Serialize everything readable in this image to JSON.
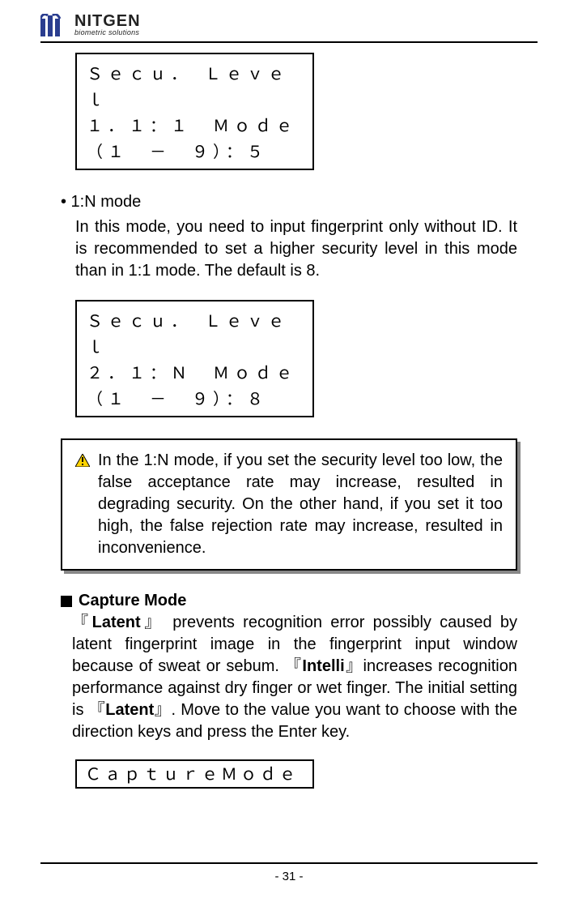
{
  "header": {
    "logo_main": "NITGEN",
    "logo_sub": "biometric solutions"
  },
  "display1": {
    "line1": "Ｓｅｃｕ．　Ｌｅｖｅｌ",
    "line2": "１．１：１　Ｍｏｄｅ",
    "line3": "（１　－　９）：５"
  },
  "bullet1": {
    "heading": "• 1:N mode",
    "text": "In this mode, you need to input fingerprint only without ID. It is recommended to set a higher security level in this mode than in 1:1 mode. The default is 8."
  },
  "display2": {
    "line1": "Ｓｅｃｕ．　Ｌｅｖｅｌ",
    "line2": "２．１：Ｎ　Ｍｏｄｅ",
    "line3": "（１　－　９）：８"
  },
  "warning": {
    "text": "In the 1:N mode, if you set the security level too low, the false acceptance rate may increase, resulted in degrading security. On the other hand, if you set it too high, the false rejection rate may increase, resulted in inconvenience."
  },
  "section2": {
    "heading": "Capture Mode",
    "body_parts": {
      "p1": "『",
      "b1": "Latent",
      "p2": "』 prevents recognition error possibly caused by latent fingerprint image in the fingerprint input window because of sweat or sebum. 『",
      "b2": "Intelli",
      "p3": "』increases recognition performance against dry finger or wet finger. The initial setting is 『",
      "b3": "Latent",
      "p4": "』. Move to the value you want to choose with the direction keys and press the Enter key."
    }
  },
  "display3": {
    "line1": "ＣａｐｔｕｒｅＭｏｄｅ"
  },
  "footer": {
    "page": "- 31 -"
  }
}
